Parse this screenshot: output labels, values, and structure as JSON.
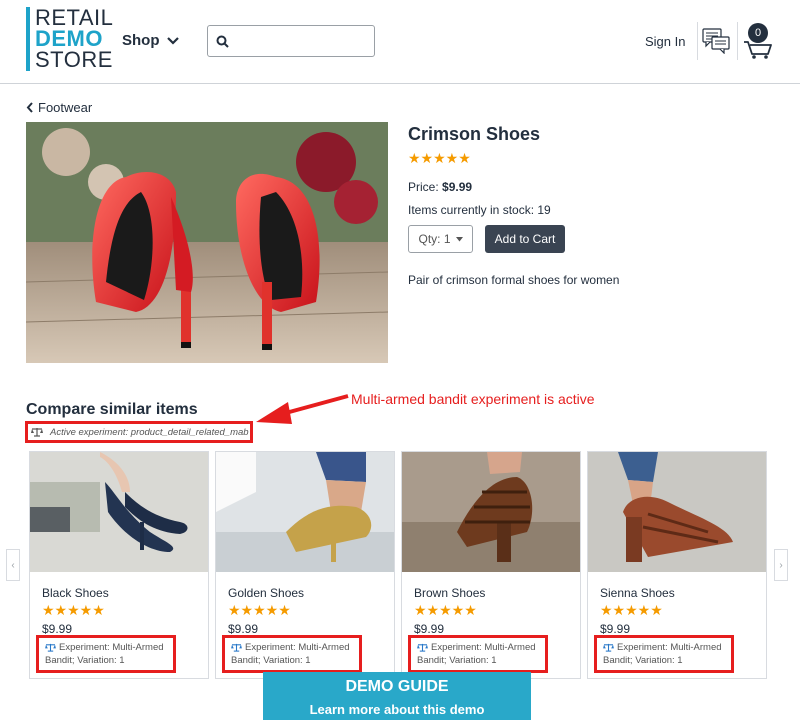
{
  "header": {
    "logo": [
      "RETAIL",
      "DEMO",
      "STORE"
    ],
    "shop_label": "Shop",
    "search_placeholder": "",
    "signin_label": "Sign In",
    "cart_count": "0"
  },
  "breadcrumb": {
    "label": "Footwear"
  },
  "product": {
    "title": "Crimson Shoes",
    "stars": "★★★★★",
    "price_label": "Price:",
    "price_value": "$9.99",
    "stock_text": "Items currently in stock: 19",
    "qty_label": "Qty: 1",
    "add_to_cart": "Add to Cart",
    "description": "Pair of crimson formal shoes for women"
  },
  "compare": {
    "title": "Compare similar items",
    "experiment": "Active experiment: product_detail_related_mab",
    "annotation": "Multi-armed bandit experiment is active",
    "items": [
      {
        "name": "Black Shoes",
        "stars": "★★★★★",
        "price": "$9.99",
        "exp_line1": "Experiment: Multi-Armed",
        "exp_line2": "Bandit; Variation: 1"
      },
      {
        "name": "Golden Shoes",
        "stars": "★★★★★",
        "price": "$9.99",
        "exp_line1": "Experiment: Multi-Armed",
        "exp_line2": "Bandit; Variation: 1"
      },
      {
        "name": "Brown Shoes",
        "stars": "★★★★★",
        "price": "$9.99",
        "exp_line1": "Experiment: Multi-Armed",
        "exp_line2": "Bandit; Variation: 1"
      },
      {
        "name": "Sienna Shoes",
        "stars": "★★★★★",
        "price": "$9.99",
        "exp_line1": "Experiment: Multi-Armed",
        "exp_line2": "Bandit; Variation: 1"
      }
    ]
  },
  "demo_guide": {
    "title": "DEMO GUIDE",
    "subtitle": "Learn more about this demo"
  },
  "colors": {
    "brand": "#1ea3c9",
    "star": "#f59b00",
    "highlight": "#e61e1e",
    "dark": "#232f3e"
  }
}
